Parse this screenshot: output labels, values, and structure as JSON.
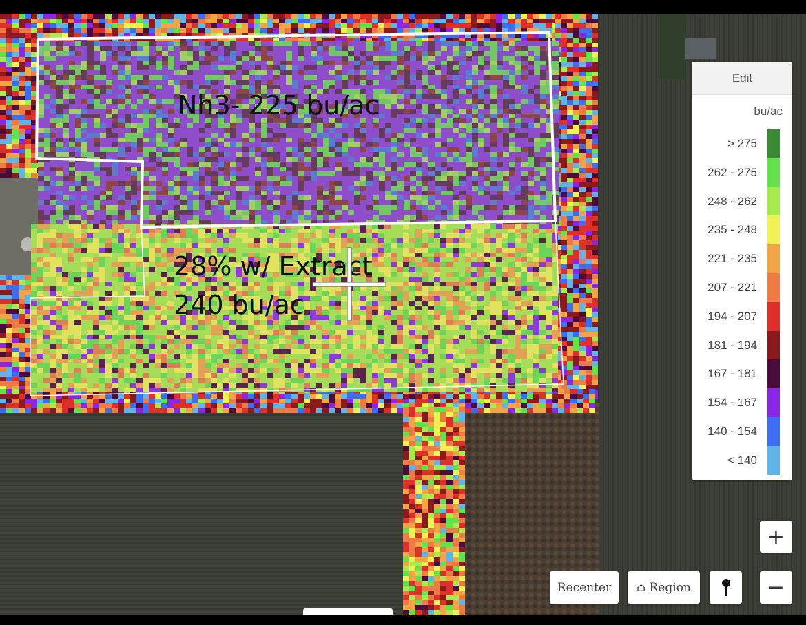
{
  "map": {
    "labels": {
      "north_field": "Nh3- 225 bu/ac",
      "south_line1": "28% w/ Extract",
      "south_line2": "240 bu/ac"
    }
  },
  "legend": {
    "edit_label": "Edit",
    "unit": "bu/ac",
    "items": [
      {
        "label": "> 275",
        "color": "#3a8a34"
      },
      {
        "label": "262 - 275",
        "color": "#62e24b"
      },
      {
        "label": "248 - 262",
        "color": "#a8ec4c"
      },
      {
        "label": "235 - 248",
        "color": "#f0f252"
      },
      {
        "label": "221 - 235",
        "color": "#f3a445"
      },
      {
        "label": "207 - 221",
        "color": "#ee7a44"
      },
      {
        "label": "194 - 207",
        "color": "#de2f2b"
      },
      {
        "label": "181 - 194",
        "color": "#8a1a1c"
      },
      {
        "label": "167 - 181",
        "color": "#4b0c3c"
      },
      {
        "label": "154 - 167",
        "color": "#8a26e6"
      },
      {
        "label": "140 - 154",
        "color": "#3b6ef2"
      },
      {
        "label": "< 140",
        "color": "#5fb4e8"
      }
    ]
  },
  "controls": {
    "recenter_label": "Recenter",
    "region_label": "⌂ Region",
    "zoom_in_label": "+",
    "zoom_out_label": "−",
    "pin_icon": "map-pin-icon"
  }
}
